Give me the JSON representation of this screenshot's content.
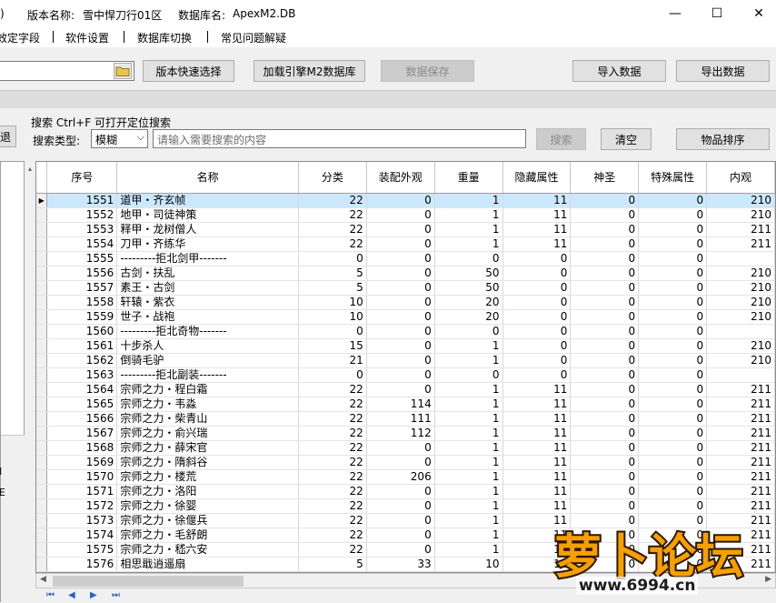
{
  "titlebar": {
    "paren": ")",
    "version_label": "版本名称:",
    "version_value": "雪中悍刀行01区",
    "db_label": "数据库名:",
    "db_value": "ApexM2.DB",
    "minimize": "—",
    "maximize": "☐",
    "close": "✕"
  },
  "menu": {
    "items": [
      "效定字段",
      "软件设置",
      "数据库切换",
      "常见问题解疑"
    ]
  },
  "toolbar": {
    "path_value": "",
    "btn_version": "版本快速选择",
    "btn_load": "加载引擎M2数据库",
    "btn_save": "数据保存",
    "btn_import": "导入数据",
    "btn_export": "导出数据"
  },
  "search": {
    "left_fragment": "退",
    "hint": "搜索  Ctrl+F 可打开定位搜索",
    "type_label": "搜索类型:",
    "type_value": "模糊",
    "placeholder": "请输入需要搜索的内容",
    "btn_search": "搜索",
    "btn_clear": "清空",
    "btn_sort": "物品排序"
  },
  "left_panel": {
    "frag1": "I",
    "frag2": "E"
  },
  "grid": {
    "columns": [
      "序号",
      "名称",
      "分类",
      "装配外观",
      "重量",
      "隐藏属性",
      "神圣",
      "特殊属性",
      "内观"
    ],
    "selected_index": 0,
    "rows": [
      [
        "1551",
        "道甲・齐玄帧",
        "22",
        "0",
        "1",
        "11",
        "0",
        "0",
        "210"
      ],
      [
        "1552",
        "地甲・司徒神策",
        "22",
        "0",
        "1",
        "11",
        "0",
        "0",
        "210"
      ],
      [
        "1553",
        "释甲・龙树僧人",
        "22",
        "0",
        "1",
        "11",
        "0",
        "0",
        "211"
      ],
      [
        "1554",
        "刀甲・齐练华",
        "22",
        "0",
        "1",
        "11",
        "0",
        "0",
        "211"
      ],
      [
        "1555",
        "---------拒北剑甲-------",
        "0",
        "0",
        "0",
        "0",
        "0",
        "0",
        ""
      ],
      [
        "1556",
        "古剑・扶乱",
        "5",
        "0",
        "50",
        "0",
        "0",
        "0",
        "210"
      ],
      [
        "1557",
        "素王・古剑",
        "5",
        "0",
        "50",
        "0",
        "0",
        "0",
        "210"
      ],
      [
        "1558",
        "轩辕・紫衣",
        "10",
        "0",
        "20",
        "0",
        "0",
        "0",
        "210"
      ],
      [
        "1559",
        "世子・战袍",
        "10",
        "0",
        "20",
        "0",
        "0",
        "0",
        "210"
      ],
      [
        "1560",
        "---------拒北奇物-------",
        "0",
        "0",
        "0",
        "0",
        "0",
        "0",
        ""
      ],
      [
        "1561",
        "十步杀人",
        "15",
        "0",
        "1",
        "0",
        "0",
        "0",
        "210"
      ],
      [
        "1562",
        "倒骑毛驴",
        "21",
        "0",
        "1",
        "0",
        "0",
        "0",
        "210"
      ],
      [
        "1563",
        "---------拒北副装-------",
        "0",
        "0",
        "0",
        "0",
        "0",
        "0",
        ""
      ],
      [
        "1564",
        "宗师之力・程白霜",
        "22",
        "0",
        "1",
        "11",
        "0",
        "0",
        "211"
      ],
      [
        "1565",
        "宗师之力・韦淼",
        "22",
        "114",
        "1",
        "11",
        "0",
        "0",
        "211"
      ],
      [
        "1566",
        "宗师之力・柴青山",
        "22",
        "111",
        "1",
        "11",
        "0",
        "0",
        "211"
      ],
      [
        "1567",
        "宗师之力・俞兴瑞",
        "22",
        "112",
        "1",
        "11",
        "0",
        "0",
        "211"
      ],
      [
        "1568",
        "宗师之力・薛宋官",
        "22",
        "0",
        "1",
        "11",
        "0",
        "0",
        "211"
      ],
      [
        "1569",
        "宗师之力・隋斜谷",
        "22",
        "0",
        "1",
        "11",
        "0",
        "0",
        "211"
      ],
      [
        "1570",
        "宗师之力・楼荒",
        "22",
        "206",
        "1",
        "11",
        "0",
        "0",
        "211"
      ],
      [
        "1571",
        "宗师之力・洛阳",
        "22",
        "0",
        "1",
        "11",
        "0",
        "0",
        "211"
      ],
      [
        "1572",
        "宗师之力・徐婴",
        "22",
        "0",
        "1",
        "11",
        "0",
        "0",
        "211"
      ],
      [
        "1573",
        "宗师之力・徐偃兵",
        "22",
        "0",
        "1",
        "11",
        "0",
        "0",
        "211"
      ],
      [
        "1574",
        "宗师之力・毛舒朗",
        "22",
        "0",
        "1",
        "11",
        "0",
        "0",
        "211"
      ],
      [
        "1575",
        "宗师之力・嵇六安",
        "22",
        "0",
        "1",
        "11",
        "0",
        "0",
        "211"
      ],
      [
        "1576",
        "相思戢逍遥扇",
        "5",
        "33",
        "10",
        "11",
        "0",
        "0",
        "211"
      ]
    ]
  },
  "watermark": {
    "brand": "萝卜论坛",
    "url": "www.6994.cn"
  },
  "colors": {
    "selection": "#cce8ff",
    "window_bg": "#f0f0f0",
    "watermark_orange": "#f5a000"
  }
}
